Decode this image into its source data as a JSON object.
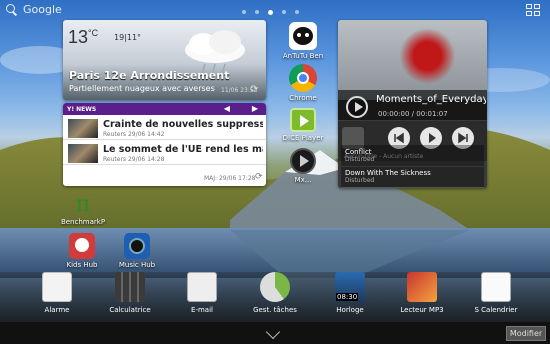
{
  "status": {
    "search_label": "Google"
  },
  "weather": {
    "temperature": "13",
    "unit": "°C",
    "minmax": "19|11°",
    "city": "Paris 12e Arrondissement",
    "condition": "Partiellement nuageux avec averses",
    "time": "11/06 23:53"
  },
  "news": {
    "header": "NEWS",
    "items": [
      {
        "title": "Crainte de nouvelles suppressio...",
        "meta": "Reuters 29/06 14:42"
      },
      {
        "title": "Le sommet de l'UE rend les marc...",
        "meta": "Reuters 29/06 14:28"
      }
    ],
    "updated": "MAJ: 29/06 17:28"
  },
  "mid_apps": [
    {
      "label": "AnTuTu Ben"
    },
    {
      "label": "Chrome"
    },
    {
      "label": "DICE Player"
    },
    {
      "label": "Mx..."
    }
  ],
  "music": {
    "song": "Moments_of_Everyday",
    "time": "00:00:00 / 00:01:07",
    "artist": "Aucun titre - Aucun artiste",
    "playlist": [
      {
        "title": "Conflict",
        "sub": "Disturbed"
      },
      {
        "title": "Down With The Sickness",
        "sub": "Disturbed"
      }
    ]
  },
  "desktop": [
    {
      "label": "BenchmarkP"
    },
    {
      "label": "Kids Hub"
    },
    {
      "label": "Music Hub"
    }
  ],
  "dock": [
    {
      "label": "Alarme"
    },
    {
      "label": "Calculatrice"
    },
    {
      "label": "E-mail"
    },
    {
      "label": "Gest. tâches"
    },
    {
      "label": "Horloge",
      "clock": "08:30"
    },
    {
      "label": "Lecteur MP3"
    },
    {
      "label": "S Calendrier"
    }
  ],
  "bottom": {
    "edit_label": "Modifier"
  }
}
